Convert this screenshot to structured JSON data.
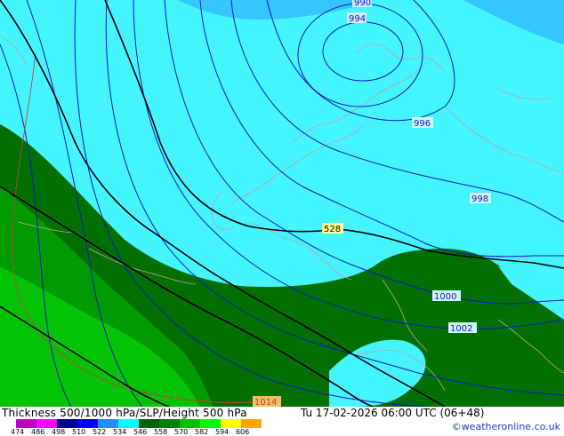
{
  "title": "Thickness 500/1000 hPa/SLP/Height 500 hPa",
  "datetime": "Tu 17-02-2026 06:00 UTC (06+48)",
  "credit": "©weatheronline.co.uk",
  "legend": {
    "ticks": [
      "474",
      "486",
      "498",
      "510",
      "522",
      "534",
      "546",
      "558",
      "570",
      "582",
      "594",
      "606"
    ],
    "colors": [
      "#c000c0",
      "#ff00ff",
      "#00008b",
      "#0000ff",
      "#1e90ff",
      "#00ffff",
      "#006400",
      "#008000",
      "#00c000",
      "#00ff00",
      "#ffff00",
      "#ffa500"
    ]
  },
  "isobar_labels": [
    "990",
    "994",
    "996",
    "998",
    "1000",
    "1002",
    "1014"
  ],
  "thickness_labels": [
    "528"
  ],
  "colors": {
    "cyan_zone": "#44f4ff",
    "light_blue_zone": "#36c6ff",
    "dark_green_zone": "#017001",
    "mid_green_zone": "#019c01",
    "bright_green_zone": "#04c304",
    "isobar": "#1414c8",
    "height_line": "#000000",
    "coastline": "#c8a0a0"
  }
}
